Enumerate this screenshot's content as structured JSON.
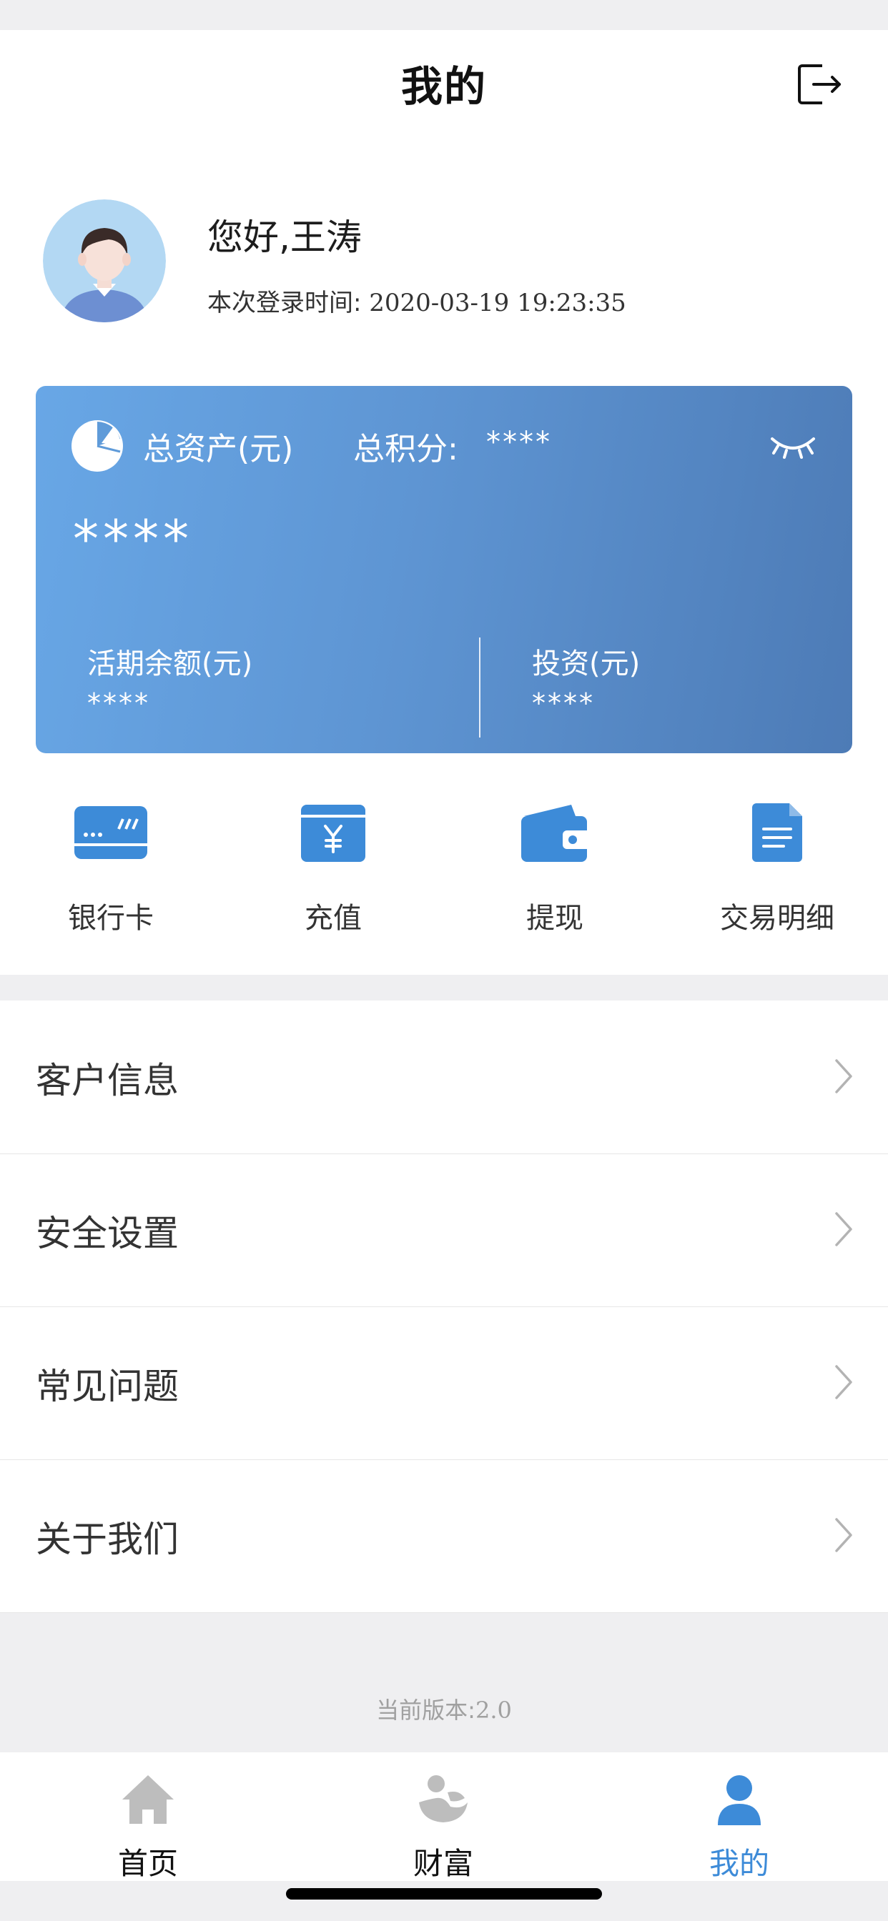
{
  "header": {
    "title": "我的"
  },
  "profile": {
    "greeting": "您好,王涛",
    "login_time_label": "本次登录时间: ",
    "login_time_value": "2020-03-19 19:23:35"
  },
  "asset_card": {
    "total_label": "总资产(元)",
    "points_label": "总积分:",
    "points_value": "****",
    "total_value": "****",
    "balance_label": "活期余额(元)",
    "balance_value": "****",
    "investment_label": "投资(元)",
    "investment_value": "****"
  },
  "quick_actions": [
    {
      "label": "银行卡",
      "icon": "bank-card-icon"
    },
    {
      "label": "充值",
      "icon": "recharge-icon"
    },
    {
      "label": "提现",
      "icon": "wallet-icon"
    },
    {
      "label": "交易明细",
      "icon": "document-icon"
    }
  ],
  "menu": [
    {
      "label": "客户信息"
    },
    {
      "label": "安全设置"
    },
    {
      "label": "常见问题"
    },
    {
      "label": "关于我们"
    }
  ],
  "version": {
    "label": "当前版本:",
    "number": "2.0"
  },
  "tabbar": [
    {
      "label": "首页",
      "icon": "home-icon",
      "active": false
    },
    {
      "label": "财富",
      "icon": "wealth-icon",
      "active": false
    },
    {
      "label": "我的",
      "icon": "user-icon",
      "active": true
    }
  ],
  "colors": {
    "accent": "#3d8bd8",
    "card_start": "#68a7e6",
    "card_end": "#4d7bb6",
    "tab_inactive_icon": "#bdbdbd",
    "page_background": "#efeff1"
  }
}
